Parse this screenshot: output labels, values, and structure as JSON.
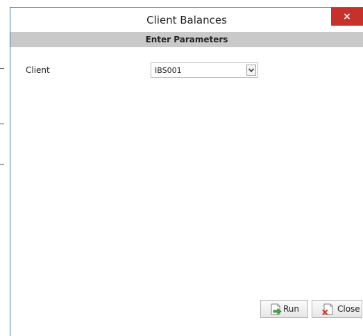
{
  "dialog": {
    "title": "Client Balances",
    "close_glyph": "×"
  },
  "section": {
    "header": "Enter Parameters"
  },
  "params": {
    "client_label": "Client",
    "client_value": "IBS001"
  },
  "buttons": {
    "run_label": "Run",
    "close_label": "Close"
  },
  "icons": {
    "close": "close-icon",
    "dropdown": "chevron-down-icon",
    "run": "run-document-icon",
    "close_doc": "close-document-icon"
  },
  "colors": {
    "accent_border": "#3c78b5",
    "close_button": "#c7312c",
    "header_band": "#c9c9c9"
  }
}
